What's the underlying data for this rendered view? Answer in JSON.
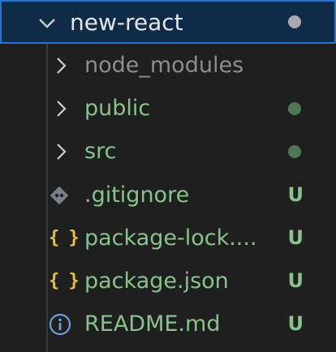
{
  "root": {
    "label": "new-react",
    "expanded": true,
    "modified_dot_color": "#a8a8ad"
  },
  "items": [
    {
      "label": "node_modules",
      "type": "folder",
      "status": "ignored",
      "color": "#8d8d8d"
    },
    {
      "label": "public",
      "type": "folder",
      "status": "untracked-dot",
      "color": "#86c48c",
      "dot_color": "#4d7a55"
    },
    {
      "label": "src",
      "type": "folder",
      "status": "untracked-dot",
      "color": "#86c48c",
      "dot_color": "#4d7a55"
    },
    {
      "label": ".gitignore",
      "type": "file",
      "icon": "git-diamond-icon",
      "badge": "U",
      "color": "#86c48c"
    },
    {
      "label": "package-lock....",
      "type": "file",
      "icon": "json-braces-icon",
      "badge": "U",
      "color": "#86c48c"
    },
    {
      "label": "package.json",
      "type": "file",
      "icon": "json-braces-icon",
      "badge": "U",
      "color": "#86c48c"
    },
    {
      "label": "README.md",
      "type": "file",
      "icon": "info-circle-icon",
      "badge": "U",
      "color": "#86c48c"
    }
  ],
  "colors": {
    "selection_bg": "#0e2b47",
    "selection_border": "#2b74c9",
    "untracked_text": "#86c48c",
    "ignored_text": "#8d8d8d",
    "json_icon": "#e8c43c",
    "info_icon": "#6e9fd6",
    "git_icon": "#7a7f8a",
    "chevron": "#cfcfcf"
  }
}
